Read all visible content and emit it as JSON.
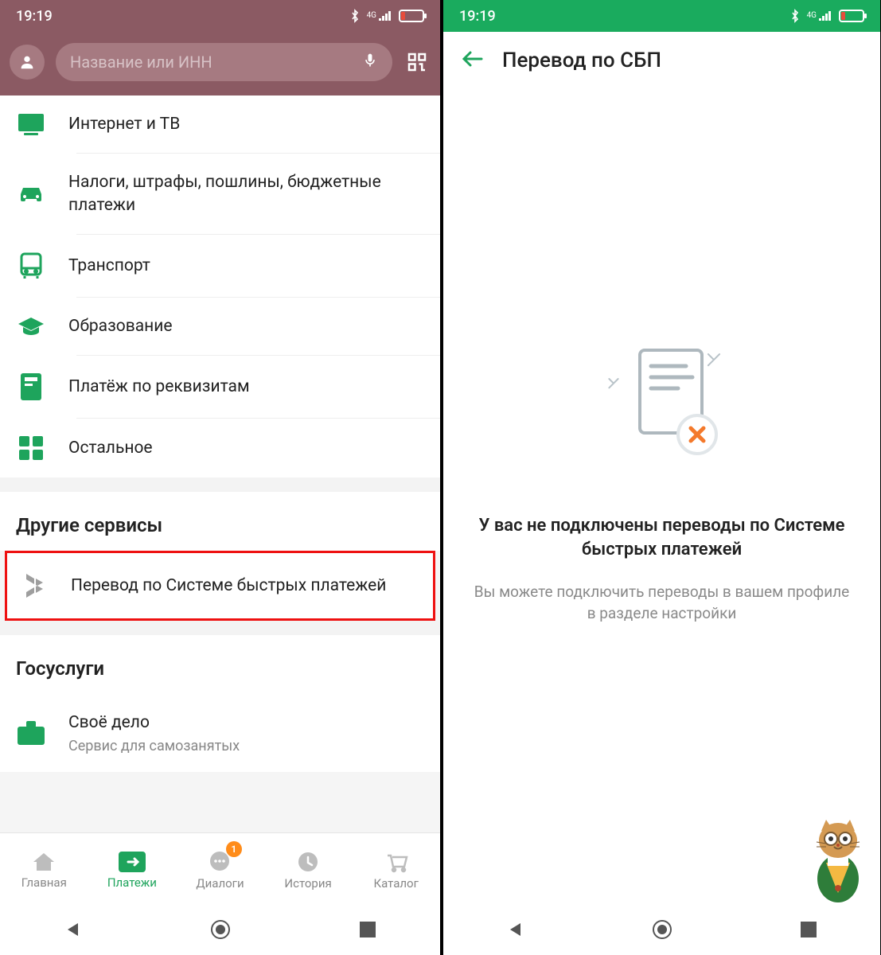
{
  "status": {
    "time": "19:19",
    "signal_label": "4G"
  },
  "left": {
    "search": {
      "placeholder": "Название или ИНН"
    },
    "categories": [
      {
        "icon": "tv-icon",
        "label": "Интернет и ТВ"
      },
      {
        "icon": "car-icon",
        "label": "Налоги, штрафы, пошлины, бюджетные платежи"
      },
      {
        "icon": "bus-icon",
        "label": "Транспорт"
      },
      {
        "icon": "grad-icon",
        "label": "Образование"
      },
      {
        "icon": "req-icon",
        "label": "Платёж по реквизитам"
      },
      {
        "icon": "grid-icon",
        "label": "Остальное"
      }
    ],
    "section_other_services": "Другие сервисы",
    "sbp_item": {
      "label": "Перевод по Системе быстрых платежей"
    },
    "section_gosuslugi": "Госуслуги",
    "gos_item": {
      "title": "Своё дело",
      "subtitle": "Сервис для самозанятых"
    },
    "bottom_nav": {
      "home": "Главная",
      "pay": "Платежи",
      "dialog": "Диалоги",
      "history": "История",
      "catalog": "Каталог",
      "badge": "1"
    }
  },
  "right": {
    "title": "Перевод по СБП",
    "headline": "У вас не подключены переводы по Системе быстрых платежей",
    "subline": "Вы можете подключить переводы в вашем профиле в разделе настройки"
  }
}
